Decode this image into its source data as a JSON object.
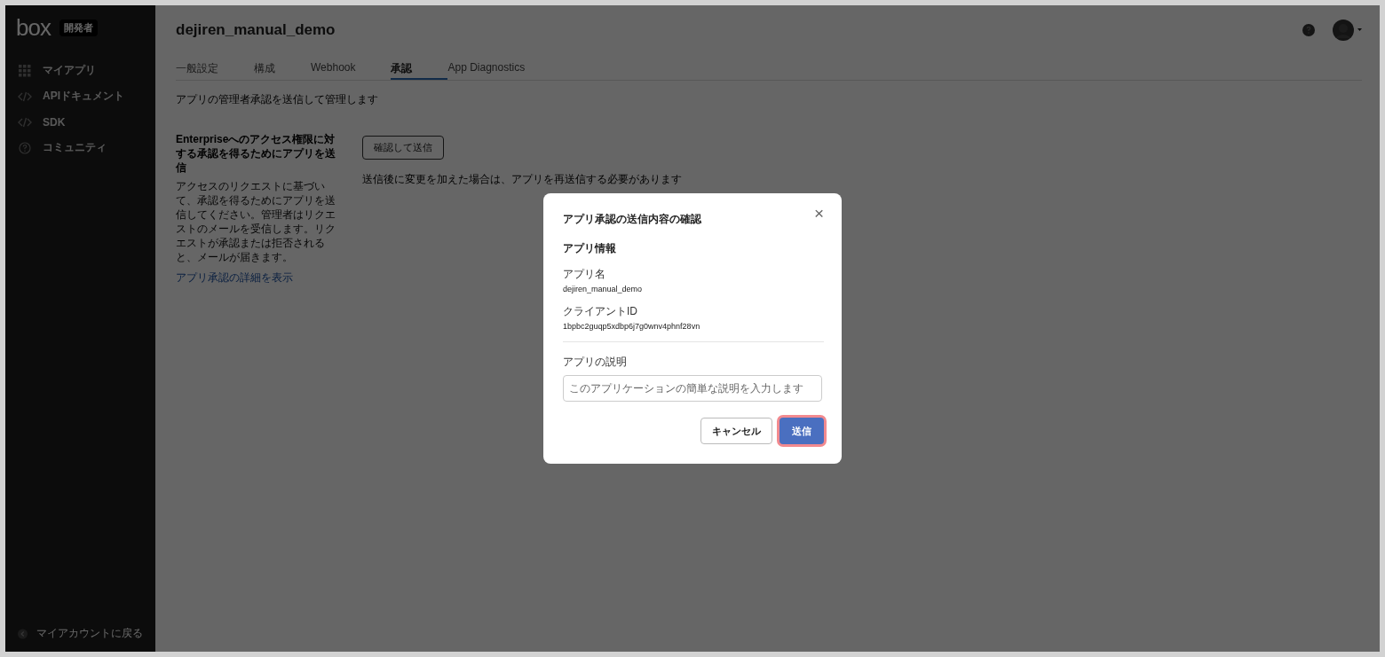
{
  "sidebar": {
    "logo": "box",
    "badge": "開発者",
    "items": [
      {
        "kind": "grid",
        "label": "マイアプリ"
      },
      {
        "kind": "code",
        "label": "APIドキュメント"
      },
      {
        "kind": "code",
        "label": "SDK"
      },
      {
        "kind": "help",
        "label": "コミュニティ"
      }
    ],
    "back_link": "マイアカウントに戻る"
  },
  "header": {
    "title": "dejiren_manual_demo"
  },
  "tabs": [
    {
      "label": "一般設定",
      "selected": false
    },
    {
      "label": "構成",
      "selected": false
    },
    {
      "label": "Webhook",
      "selected": false
    },
    {
      "label": "承認",
      "selected": true
    },
    {
      "label": "App Diagnostics",
      "selected": false
    }
  ],
  "page": {
    "description": "アプリの管理者承認を送信して管理します",
    "section_title": "Enterpriseへのアクセス権限に対する承認を得るためにアプリを送信",
    "section_text": "アクセスのリクエストに基づいて、承認を得るためにアプリを送信してください。管理者はリクエストのメールを受信します。リクエストが承認または拒否されると、メールが届きます。",
    "section_link": "アプリ承認の詳細を表示",
    "submit_button": "確認して送信",
    "note": "送信後に変更を加えた場合は、アプリを再送信する必要があります"
  },
  "dialog": {
    "title": "アプリ承認の送信内容の確認",
    "close": "×",
    "section": "アプリ情報",
    "fields": [
      {
        "label": "アプリ名",
        "value": "dejiren_manual_demo"
      },
      {
        "label": "クライアントID",
        "value": "1bpbc2guqp5xdbp6j7g0wnv4phnf28vn"
      }
    ],
    "description_label": "アプリの説明",
    "description_placeholder": "このアプリケーションの簡単な説明を入力します",
    "cancel": "キャンセル",
    "submit": "送信",
    "submit_highlighted": true
  }
}
